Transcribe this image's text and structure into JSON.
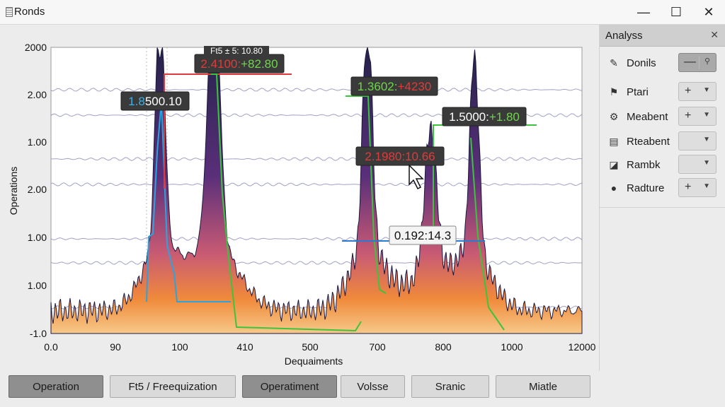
{
  "window": {
    "title": "Ronds",
    "icon": "document-icon"
  },
  "window_controls": {
    "minimize": "—",
    "maximize": "☐",
    "close": "✕"
  },
  "chart_data": {
    "type": "area",
    "ylabel": "Operations",
    "xlabel": "Dequaiments",
    "x_ticks": [
      "0.0",
      "90",
      "100",
      "410",
      "500",
      "700",
      "800",
      "1000",
      "12000"
    ],
    "y_ticks": [
      "2000",
      "2.00",
      "1.00",
      "2.00",
      "1.00",
      "1.00",
      "-1.0"
    ],
    "peaks": [
      {
        "x_label_pos": 1.6,
        "height": 0.86
      },
      {
        "x_label_pos": 2.5,
        "height": 0.92
      },
      {
        "x_label_pos": 4.9,
        "height": 0.85
      },
      {
        "x_label_pos": 5.85,
        "height": 0.5
      },
      {
        "x_label_pos": 6.5,
        "height": 0.7
      }
    ],
    "annotations": [
      {
        "text_a": "2.4100:",
        "text_b": "+82.80",
        "color_a": "#e03a3a",
        "color_b": "#6fd64a"
      },
      {
        "text_a": "1.8",
        "text_b": "500.10",
        "color_a": "#3ab0e8",
        "color_b": "#ffffff"
      },
      {
        "text_a": "1.3602:",
        "text_b": "+4230",
        "color_a": "#6fd64a",
        "color_b": "#e03a3a"
      },
      {
        "text_a": "1.5000:",
        "text_b": "+1.80",
        "color_a": "#ffffff",
        "color_b": "#6fd64a"
      },
      {
        "text_a": "2.1980:",
        "text_b": "10.66",
        "color_a": "#e03a3a",
        "color_b": "#e03a3a"
      },
      {
        "text_a": "0.192:",
        "text_b": "14.3",
        "color_a": "#111111",
        "color_b": "#111111"
      }
    ],
    "top_annotation": "Ft5 ± 5: 10.80"
  },
  "panel": {
    "title": "Analyss",
    "close": "✕",
    "rows": [
      {
        "label": "Donils",
        "icon": "edit-icon",
        "glyph": "✎",
        "control": "minus-pin"
      },
      {
        "label": "Ptari",
        "icon": "flag-icon",
        "glyph": "⚑",
        "control": "plus-caret"
      },
      {
        "label": "Meabent",
        "icon": "gear-icon",
        "glyph": "⚙",
        "control": "plus-caret"
      },
      {
        "label": "Rteabent",
        "icon": "doc-icon",
        "glyph": "▤",
        "control": "caret"
      },
      {
        "label": "Rambk",
        "icon": "chart-icon",
        "glyph": "◪",
        "control": "caret"
      },
      {
        "label": "Radture",
        "icon": "user-icon",
        "glyph": "●",
        "control": "plus-caret"
      }
    ]
  },
  "bottom_buttons": [
    {
      "label": "Operation",
      "dark": true
    },
    {
      "label": "Ft5 / Freequization",
      "dark": false
    },
    {
      "label": "Operatiment",
      "dark": true
    },
    {
      "label": "Volsse",
      "dark": false
    },
    {
      "label": "Sranic",
      "dark": false
    },
    {
      "label": "Miatle",
      "dark": false
    }
  ]
}
